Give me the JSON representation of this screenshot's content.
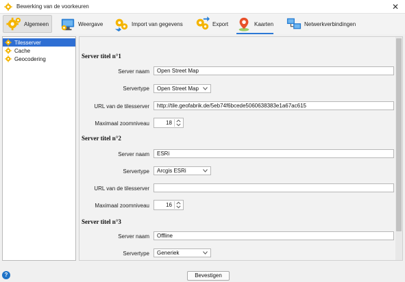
{
  "window": {
    "title": "Bewerking van de voorkeuren",
    "close_glyph": "✕"
  },
  "tabs": [
    {
      "label": "Algemeen",
      "icon": "gear-icon"
    },
    {
      "label": "Weergave",
      "icon": "monitor-icon"
    },
    {
      "label": "Import van gegevens",
      "icon": "import-gears-icon"
    },
    {
      "label": "Export",
      "icon": "export-gears-icon"
    },
    {
      "label": "Kaarten",
      "icon": "map-pin-icon"
    },
    {
      "label": "Netwerkverbindingen",
      "icon": "network-icon"
    }
  ],
  "sidebar": {
    "items": [
      {
        "label": "Tilesserver",
        "selected": true
      },
      {
        "label": "Cache"
      },
      {
        "label": "Geocodering"
      }
    ]
  },
  "servers": [
    {
      "heading": "Server titel n°1",
      "name_label": "Server naam",
      "name_value": "Open Street Map",
      "type_label": "Servertype",
      "type_value": "Open Street Map",
      "url_label": "URL van de tilesserver",
      "url_value": "http://tile.geofabrik.de/5eb74f6bcede5060638383e1a67ac615",
      "zoom_label": "Maximaal zoomniveau",
      "zoom_value": "18"
    },
    {
      "heading": "Server titel n°2",
      "name_label": "Server naam",
      "name_value": "ESRi",
      "type_label": "Servertype",
      "type_value": "Arcgis ESRi",
      "url_label": "URL van de tilesserver",
      "url_value": "",
      "zoom_label": "Maximaal zoomniveau",
      "zoom_value": "16"
    },
    {
      "heading": "Server titel n°3",
      "name_label": "Server naam",
      "name_value": "Offline",
      "type_label": "Servertype",
      "type_value": "Generiek"
    }
  ],
  "footer": {
    "confirm_label": "Bevestigen",
    "help_glyph": "?"
  },
  "colors": {
    "accent": "#2b78d6",
    "selection": "#2f6fd3",
    "gear": "#f4b400"
  }
}
